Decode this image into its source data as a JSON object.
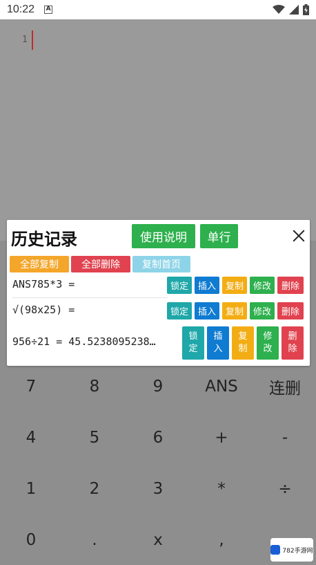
{
  "status_bar": {
    "time": "10:22",
    "notification_icon": "a-icon"
  },
  "editor": {
    "line_number": "1"
  },
  "keypad": {
    "keys": [
      [
        "7",
        "8",
        "9",
        "ANS",
        "连删"
      ],
      [
        "4",
        "5",
        "6",
        "+",
        "-"
      ],
      [
        "1",
        "2",
        "3",
        "*",
        "÷"
      ],
      [
        "0",
        ".",
        "x",
        ",",
        ""
      ]
    ]
  },
  "dialog": {
    "title": "历史记录",
    "usage_button": "使用说明",
    "single_row_button": "单行",
    "copy_all": "全部复制",
    "delete_all": "全部删除",
    "copy_first": "复制首页",
    "history": [
      {
        "expr": "ANS785*3 ="
      },
      {
        "expr": "√(98x25) ="
      },
      {
        "expr": "956÷21 = 45.5238095238…"
      }
    ],
    "row_actions": {
      "lock": "锁定",
      "insert": "插入",
      "copy": "复制",
      "edit": "修改",
      "delete": "删除"
    },
    "row_actions_vertical": {
      "lock": "锁\n定",
      "insert": "插\n入",
      "copy": "复\n制",
      "edit": "修\n改",
      "delete": "删\n除"
    }
  },
  "watermark": {
    "text": "782手游网"
  },
  "colors": {
    "green": "#2db04d",
    "orange": "#f4a62a",
    "red": "#e0434f",
    "light_blue": "#8ed4e8",
    "teal": "#1fa7a9",
    "blue": "#0f7bd1",
    "cursor": "#c42b2b"
  }
}
